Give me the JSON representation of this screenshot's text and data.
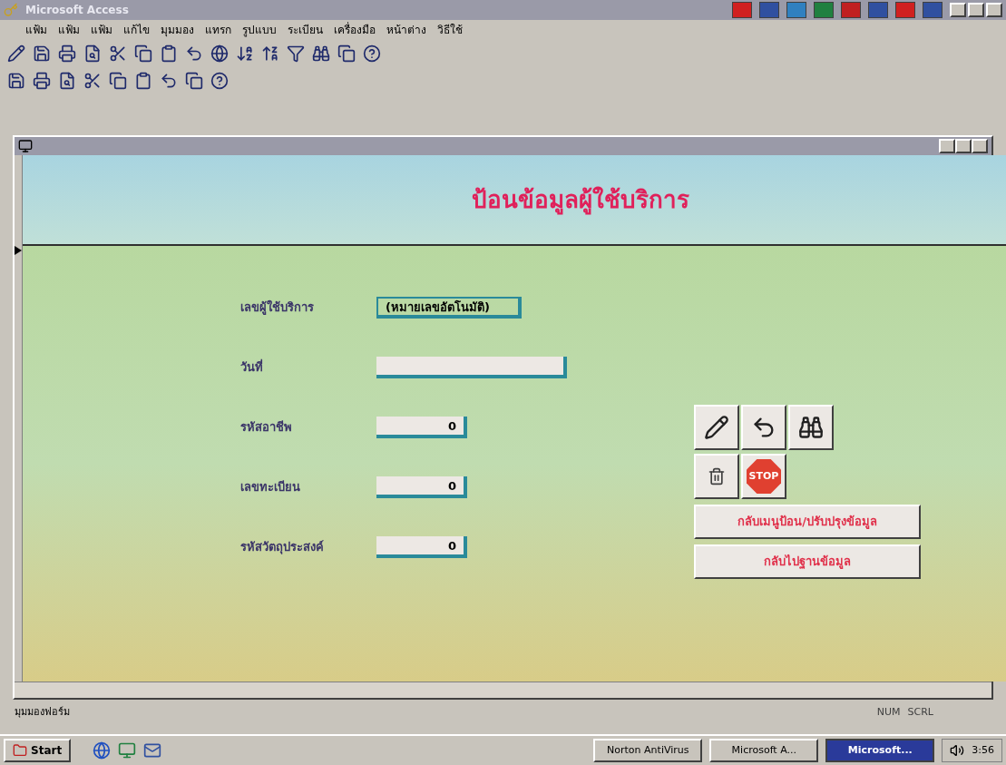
{
  "window": {
    "title": "Microsoft Access"
  },
  "menu": [
    "แฟ้ม",
    "แฟ้ม",
    "แฟ้ม",
    "แก้ไข",
    "มุมมอง",
    "แทรก",
    "รูปแบบ",
    "ระเบียน",
    "เครื่องมือ",
    "หน้าต่าง",
    "วิธีใช้"
  ],
  "form": {
    "heading": "ป้อนข้อมูลผู้ใช้บริการ",
    "fields": [
      {
        "label": "เลขผู้ใช้บริการ",
        "value": "(หมายเลขอัตโนมัติ)",
        "kind": "auto"
      },
      {
        "label": "วันที่",
        "kind": "wide"
      },
      {
        "label": "รหัสอาชีพ",
        "value": "0",
        "kind": "number"
      },
      {
        "label": "เลขทะเบียน",
        "value": "0",
        "kind": "number"
      },
      {
        "label": "รหัสวัตถุประสงค์",
        "value": "0",
        "kind": "number"
      }
    ],
    "stop_label": "STOP",
    "buttons": [
      "กลับเมนูป้อน/ปรับปรุงข้อมูล",
      "กลับไปฐานข้อมูล"
    ]
  },
  "status_bar": {
    "text": "มุมมองฟอร์ม",
    "indicators": [
      "NUM",
      "SCRL"
    ]
  },
  "taskbar": {
    "start": "Start",
    "tasks": [
      {
        "label": "Norton AntiVirus",
        "selected": false
      },
      {
        "label": "Microsoft A...",
        "selected": false
      },
      {
        "label": "Microsoft...",
        "selected": true
      }
    ],
    "clock": "3:56"
  }
}
